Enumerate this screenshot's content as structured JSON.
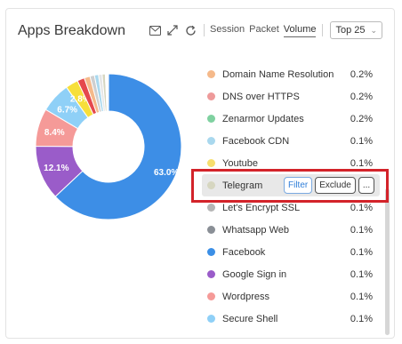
{
  "widget": {
    "title": "Apps Breakdown",
    "tabs": [
      {
        "label": "Session",
        "active": false
      },
      {
        "label": "Packet",
        "active": false
      },
      {
        "label": "Volume",
        "active": true
      }
    ],
    "top_select": "Top 25",
    "icons": [
      "mail-icon",
      "expand-icon",
      "refresh-icon"
    ]
  },
  "legend": {
    "hover_actions": {
      "filter": "Filter",
      "exclude": "Exclude",
      "more": "..."
    },
    "items": [
      {
        "label": "Domain Name Resolution",
        "value": "0.2%",
        "color": "#f5b98a"
      },
      {
        "label": "DNS over HTTPS",
        "value": "0.2%",
        "color": "#ee9a9a"
      },
      {
        "label": "Zenarmor Updates",
        "value": "0.2%",
        "color": "#7fd1a0"
      },
      {
        "label": "Facebook CDN",
        "value": "0.1%",
        "color": "#a9d8ee"
      },
      {
        "label": "Youtube",
        "value": "0.1%",
        "color": "#f7df6e"
      },
      {
        "label": "Telegram",
        "value": "",
        "color": "#d6d6c0"
      },
      {
        "label": "Let's Encrypt SSL",
        "value": "0.1%",
        "color": "#b5b5b5"
      },
      {
        "label": "Whatsapp Web",
        "value": "0.1%",
        "color": "#8a8f96"
      },
      {
        "label": "Facebook",
        "value": "0.1%",
        "color": "#3b8fe6"
      },
      {
        "label": "Google Sign in",
        "value": "0.1%",
        "color": "#9a5cc9"
      },
      {
        "label": "Wordpress",
        "value": "0.1%",
        "color": "#f59a98"
      },
      {
        "label": "Secure Shell",
        "value": "0.1%",
        "color": "#8fd0f7"
      }
    ]
  },
  "chart_data": {
    "type": "pie",
    "donut": true,
    "slices": [
      {
        "label": "63.0%",
        "value": 63.0,
        "color": "#3d8ee6"
      },
      {
        "label": "12.1%",
        "value": 12.1,
        "color": "#9a5cc9"
      },
      {
        "label": "8.4%",
        "value": 8.4,
        "color": "#f59a98"
      },
      {
        "label": "6.7%",
        "value": 6.7,
        "color": "#8fd0f7"
      },
      {
        "label": "2.8%",
        "value": 2.8,
        "color": "#f7df3a"
      },
      {
        "label": "",
        "value": 1.6,
        "color": "#e5484d"
      },
      {
        "label": "",
        "value": 1.3,
        "color": "#f5b98a"
      },
      {
        "label": "",
        "value": 1.0,
        "color": "#cfcfcf"
      },
      {
        "label": "",
        "value": 0.9,
        "color": "#a9d8ee"
      },
      {
        "label": "",
        "value": 0.8,
        "color": "#e6e6e6"
      },
      {
        "label": "",
        "value": 0.7,
        "color": "#d6d6c0"
      },
      {
        "label": "",
        "value": 0.7,
        "color": "#ffffff"
      }
    ]
  }
}
